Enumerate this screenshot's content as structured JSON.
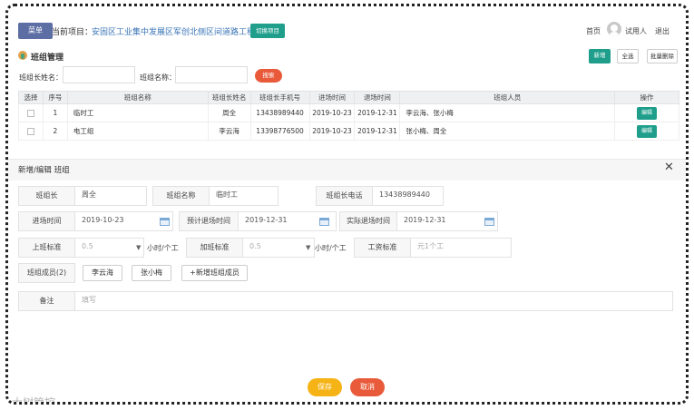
{
  "header": {
    "menu_label": "菜单",
    "project_label": "当前项目：",
    "project_name": "安固区工业集中发展区军创北侧区间道路工程",
    "switch_label": "切换项目",
    "home_link": "首页",
    "user_name": "试用人",
    "logout_link": "退出"
  },
  "page": {
    "title": "班组管理",
    "add_label": "新增",
    "select_all_label": "全选",
    "batch_delete_label": "批量删除"
  },
  "search": {
    "leader_label": "班组长姓名：",
    "leader_value": "",
    "group_label": "班组名称：",
    "group_value": "",
    "button_label": "搜索"
  },
  "table": {
    "columns": [
      "选择",
      "序号",
      "班组名称",
      "班组长姓名",
      "班组长手机号",
      "进场时间",
      "退场时间",
      "班组人员",
      "操作"
    ],
    "rows": [
      {
        "no": "1",
        "name": "临时工",
        "leader": "周全",
        "phone": "13438989440",
        "enter": "2019-10-23",
        "exit": "2019-12-31",
        "members": "李云海、张小梅",
        "action": "编辑"
      },
      {
        "no": "2",
        "name": "电工组",
        "leader": "李云海",
        "phone": "13398776500",
        "enter": "2019-10-23",
        "exit": "2019-12-31",
        "members": "张小梅、周全",
        "action": "编辑"
      }
    ]
  },
  "dialog": {
    "title": "新增/编辑 班组",
    "close_icon": "close-icon",
    "leader_label": "班组长",
    "leader_value": "周全",
    "group_name_label": "班组名称",
    "group_name_value": "临时工",
    "phone_label": "班组长电话",
    "phone_value": "13438989440",
    "enter_label": "进场时间",
    "enter_value": "2019-10-23",
    "planned_exit_label": "预计退场时间",
    "planned_exit_value": "2019-12-31",
    "actual_exit_label": "实际退场时间",
    "actual_exit_value": "2019-12-31",
    "shift_label": "上班标准",
    "shift_value": "0.5",
    "shift_unit": "小时/个工",
    "overtime_label": "加班标准",
    "overtime_value": "0.5",
    "overtime_unit": "小时/个工",
    "wage_label": "工资标准",
    "wage_placeholder": "元1个工",
    "members_label": "班组成员(2)",
    "members": [
      "李云海",
      "张小梅"
    ],
    "add_member_label": "+新增班组成员",
    "remark_label": "备注",
    "remark_placeholder": "填写",
    "save_label": "保存",
    "cancel_label": "取消"
  },
  "watermark": "大树管控",
  "colors": {
    "teal": "#1e9e8b",
    "red": "#e85a3a",
    "yellow": "#f5b316",
    "menu": "#5d6ea5"
  }
}
